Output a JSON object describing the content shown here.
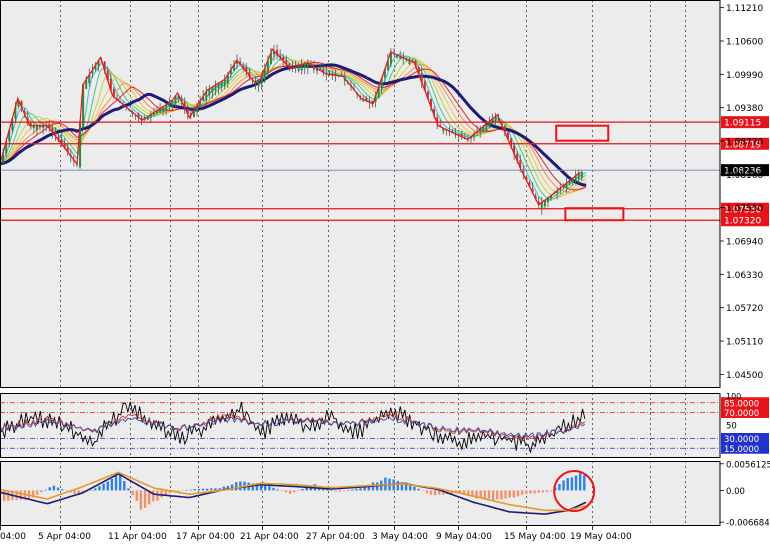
{
  "chart_data": [
    {
      "type": "candlestick",
      "panel": "price",
      "title": "",
      "yticks": [
        "1.11210",
        "1.10600",
        "1.09990",
        "1.09380",
        "1.08770",
        "1.08160",
        "1.07550",
        "1.06940",
        "1.06330",
        "1.05720",
        "1.05110",
        "1.04500"
      ],
      "ylim": [
        1.0425,
        1.1135
      ],
      "level_labels": [
        "1.09115",
        "1.08719",
        "1.07530",
        "1.07320"
      ],
      "levels": [
        1.09115,
        1.08719,
        1.0753,
        1.0732
      ],
      "current_price_label": "1.08236",
      "current_price": 1.08236,
      "close_path": {
        "t": [
          0,
          3,
          5,
          8,
          13,
          14,
          17,
          19,
          24,
          29,
          30,
          32,
          35,
          38,
          40,
          43,
          44,
          46,
          49,
          52,
          55,
          58,
          61,
          63,
          66,
          70,
          74,
          79,
          84,
          88,
          91,
          94,
          98
        ],
        "price": [
          1.0835,
          1.0955,
          1.0905,
          1.0905,
          1.0835,
          1.098,
          1.103,
          1.096,
          1.0915,
          1.095,
          1.0965,
          1.092,
          1.097,
          1.099,
          1.1025,
          1.0985,
          1.099,
          1.1045,
          1.101,
          1.102,
          1.1,
          1.0995,
          1.0955,
          1.0945,
          1.104,
          1.102,
          1.0905,
          1.088,
          1.0925,
          1.0825,
          1.076,
          1.0785,
          1.082
        ]
      },
      "annotation_boxes": [
        "upper-target",
        "lower-target"
      ],
      "x_categories": [
        "04:00",
        "5 Apr 04:00",
        "11 Apr 04:00",
        "17 Apr 04:00",
        "21 Apr 04:00",
        "27 Apr 04:00",
        "3 May 04:00",
        "9 May 04:00",
        "15 May 04:00",
        "19 May 04:00"
      ],
      "colors": {
        "zigzag": "#e8141c",
        "levels": "#e8141c",
        "ma_slow": "#1c1c78",
        "ribbon": [
          "#2dbbcf",
          "#46c46a",
          "#b7d23c",
          "#f1c33a",
          "#ef8a38",
          "#e8141c"
        ],
        "current": "#6f81b0"
      }
    },
    {
      "type": "line",
      "panel": "oscillator",
      "ylim": [
        0,
        100
      ],
      "level_labels": [
        "85.0000",
        "70.0000",
        "30.0000",
        "15.0000"
      ],
      "levels": [
        85,
        70,
        30,
        15
      ],
      "mid_label": "50",
      "top_label": "100",
      "series": [
        {
          "color": "#000000",
          "t": [
            0,
            5,
            8,
            12,
            16,
            18,
            22,
            28,
            30,
            33,
            36,
            39,
            41,
            44,
            48,
            52,
            56,
            59,
            62,
            66,
            70,
            74,
            78,
            82,
            86,
            90,
            94,
            97,
            99
          ],
          "values": [
            45,
            70,
            65,
            50,
            30,
            60,
            85,
            50,
            38,
            48,
            62,
            75,
            80,
            45,
            70,
            55,
            72,
            45,
            55,
            82,
            60,
            40,
            30,
            42,
            35,
            25,
            48,
            62,
            75
          ]
        },
        {
          "color": "#c0392b",
          "t": [
            0,
            8,
            16,
            22,
            30,
            38,
            44,
            52,
            60,
            66,
            74,
            82,
            90,
            96,
            99
          ],
          "values": [
            50,
            62,
            44,
            70,
            45,
            68,
            55,
            62,
            55,
            70,
            45,
            42,
            32,
            48,
            62
          ]
        },
        {
          "color": "#3b4ba8",
          "t": [
            0,
            8,
            16,
            22,
            30,
            38,
            44,
            52,
            60,
            66,
            74,
            82,
            90,
            96,
            99
          ],
          "values": [
            48,
            58,
            46,
            64,
            47,
            62,
            56,
            60,
            55,
            64,
            48,
            44,
            36,
            46,
            58
          ]
        }
      ]
    },
    {
      "type": "bar",
      "panel": "histogram",
      "yticks": [
        "0.0056125",
        "0.00",
        "-0.0066846"
      ],
      "ylim": [
        -0.0075,
        0.0062
      ],
      "bars": {
        "t": [
          0,
          5,
          9,
          13,
          17,
          20,
          24,
          27,
          29,
          33,
          37,
          41,
          45,
          49,
          53,
          57,
          61,
          65,
          69,
          73,
          77,
          81,
          85,
          89,
          93,
          95,
          98
        ],
        "values": [
          -0.0028,
          -0.002,
          0.0012,
          -0.0012,
          0.001,
          0.0042,
          -0.0045,
          -0.0018,
          -0.0004,
          0.0003,
          0.0005,
          0.0022,
          0.0012,
          -0.0008,
          0.0014,
          -0.0004,
          0.0006,
          0.0028,
          0.0016,
          -0.0012,
          -0.0006,
          -0.002,
          -0.0022,
          -0.0008,
          -0.0003,
          0.0022,
          0.0038
        ]
      },
      "signal": {
        "t": [
          0,
          8,
          14,
          20,
          26,
          32,
          38,
          44,
          50,
          56,
          62,
          68,
          74,
          80,
          86,
          92,
          96,
          99
        ],
        "values": [
          -0.0004,
          -0.0028,
          -0.0005,
          0.0035,
          -0.0008,
          -0.0015,
          0.0002,
          0.0012,
          0.0008,
          0.0003,
          0.0008,
          0.0015,
          0.0002,
          -0.0025,
          -0.0045,
          -0.005,
          -0.0042,
          -0.0025
        ]
      },
      "trend": {
        "t": [
          0,
          8,
          14,
          20,
          26,
          32,
          38,
          44,
          50,
          56,
          62,
          68,
          74,
          80,
          86,
          92,
          96,
          99
        ],
        "values": [
          0.0002,
          -0.0018,
          0.0008,
          0.0038,
          0.0005,
          -0.0008,
          0.0001,
          0.0015,
          0.0012,
          0.0006,
          0.001,
          0.0014,
          0.0004,
          -0.0012,
          -0.003,
          -0.0042,
          -0.0042,
          -0.0032
        ]
      },
      "colors": {
        "positive": "#2f7fe6",
        "negative": "#f0916b",
        "signal": "#1c1c78",
        "trend": "#e79a2a",
        "circle": "#e8141c"
      }
    }
  ]
}
